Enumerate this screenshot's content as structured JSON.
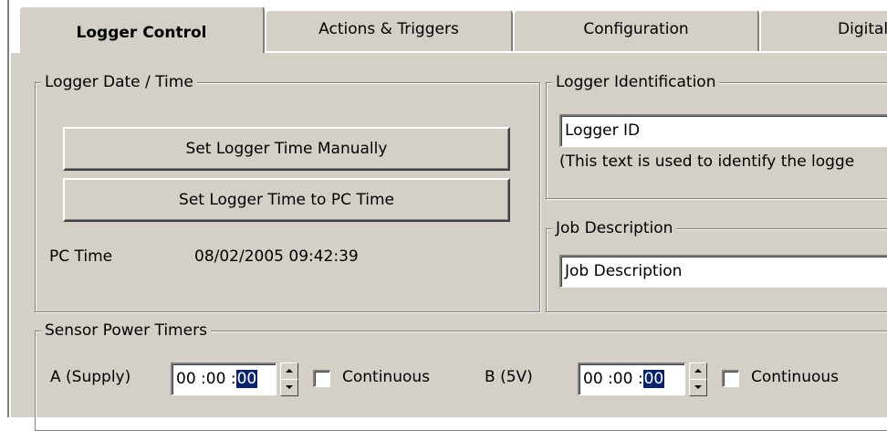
{
  "tabs": [
    {
      "label": "Logger Control",
      "active": true
    },
    {
      "label": "Actions & Triggers",
      "active": false
    },
    {
      "label": "Configuration",
      "active": false
    },
    {
      "label": "Digital/",
      "active": false
    }
  ],
  "logger_datetime": {
    "title": "Logger Date / Time",
    "set_manual_label": "Set Logger Time Manually",
    "set_pc_label": "Set Logger Time to PC Time",
    "pc_time_label": "PC Time",
    "pc_time_value": "08/02/2005 09:42:39"
  },
  "logger_identification": {
    "title": "Logger Identification",
    "value": "Logger ID",
    "hint": "(This text is used to identify the logge"
  },
  "job_description": {
    "title": "Job Description",
    "value": "Job Description"
  },
  "sensor_power": {
    "title": "Sensor Power Timers",
    "a": {
      "label": "A (Supply)",
      "hh": "00",
      "mm": "00",
      "ss": "00",
      "continuous_label": "Continuous",
      "continuous_checked": false
    },
    "b": {
      "label": "B (5V)",
      "hh": "00",
      "mm": "00",
      "ss": "00",
      "continuous_label": "Continuous",
      "continuous_checked": false
    }
  },
  "colors": {
    "face": "#d4d0c8",
    "selection": "#0a246a"
  }
}
